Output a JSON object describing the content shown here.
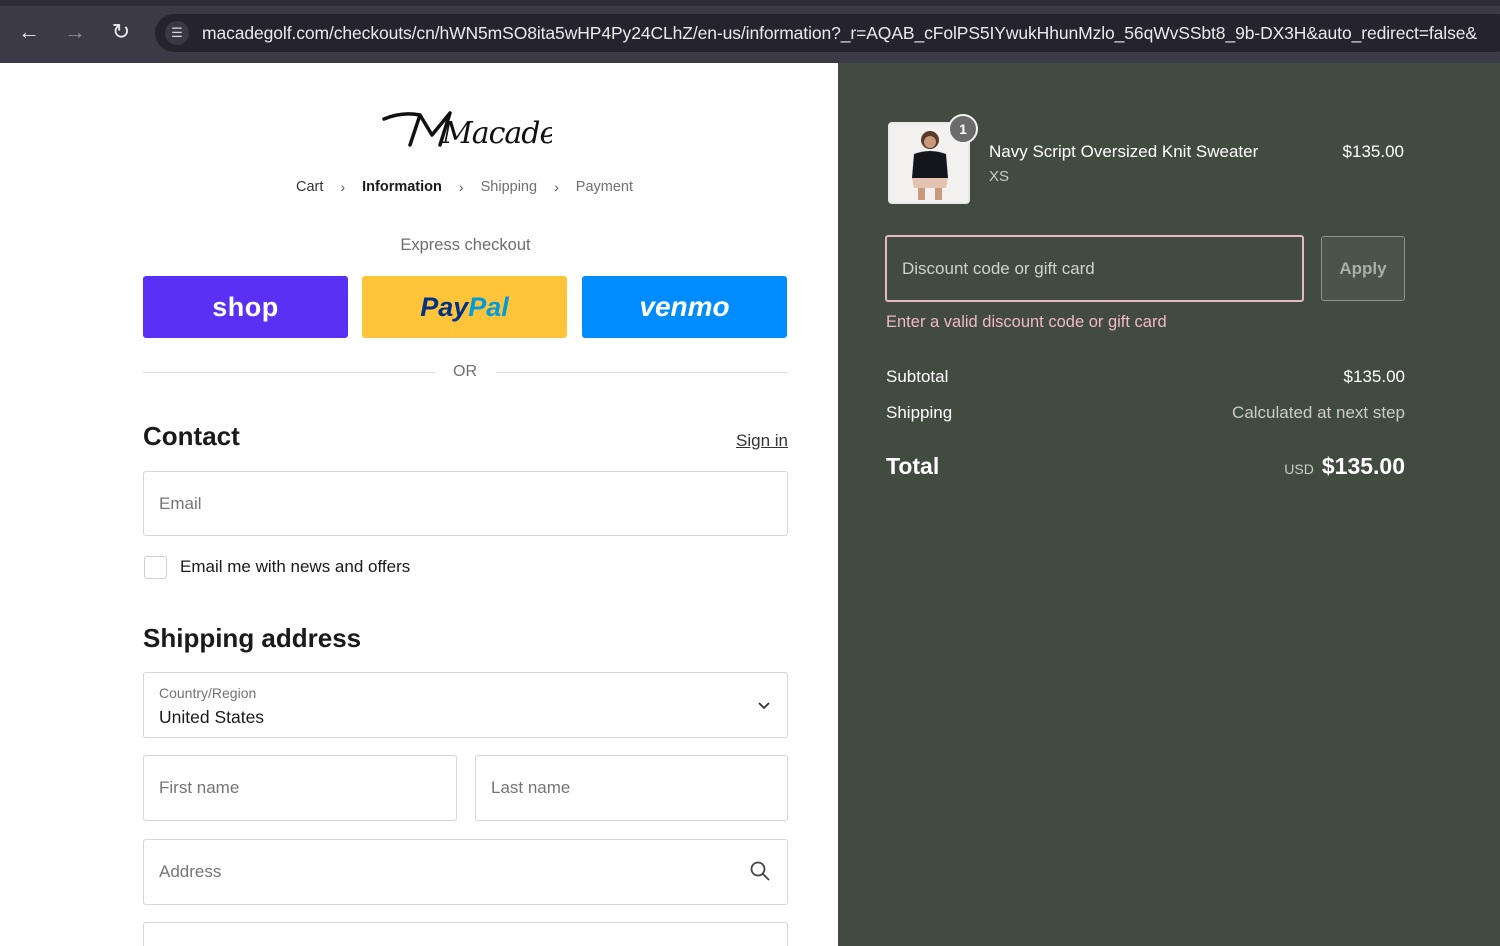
{
  "browser": {
    "url": "macadegolf.com/checkouts/cn/hWN5mSO8ita5wHP4Py24CLhZ/en-us/information?_r=AQAB_cFolPS5IYwukHhunMzlo_56qWvSSbt8_9b-DX3H&auto_redirect=false&"
  },
  "brand": {
    "logo_text": "Macade"
  },
  "breadcrumb": {
    "cart": "Cart",
    "information": "Information",
    "shipping": "Shipping",
    "payment": "Payment"
  },
  "express": {
    "title": "Express checkout",
    "shop_label": "shop",
    "paypal_label_1": "Pay",
    "paypal_label_2": "Pal",
    "venmo_label": "venmo",
    "or_label": "OR"
  },
  "contact": {
    "heading": "Contact",
    "sign_in": "Sign in",
    "email_placeholder": "Email",
    "newsletter_label": "Email me with news and offers"
  },
  "shipping_address": {
    "heading": "Shipping address",
    "country_label": "Country/Region",
    "country_value": "United States",
    "first_name_placeholder": "First name",
    "last_name_placeholder": "Last name",
    "address_placeholder": "Address"
  },
  "order": {
    "item": {
      "name": "Navy Script Oversized Knit Sweater",
      "variant": "XS",
      "price": "$135.00",
      "quantity": "1"
    },
    "discount_placeholder": "Discount code or gift card",
    "apply_label": "Apply",
    "discount_error": "Enter a valid discount code or gift card",
    "subtotal_label": "Subtotal",
    "subtotal_value": "$135.00",
    "shipping_label": "Shipping",
    "shipping_value": "Calculated at next step",
    "total_label": "Total",
    "total_currency": "USD",
    "total_value": "$135.00"
  },
  "colors": {
    "sidebar_bg": "#424b40",
    "shop_purple": "#5a31f4",
    "paypal_yellow": "#ffc439",
    "venmo_blue": "#008cff",
    "error_pink": "#f0b9c3"
  }
}
